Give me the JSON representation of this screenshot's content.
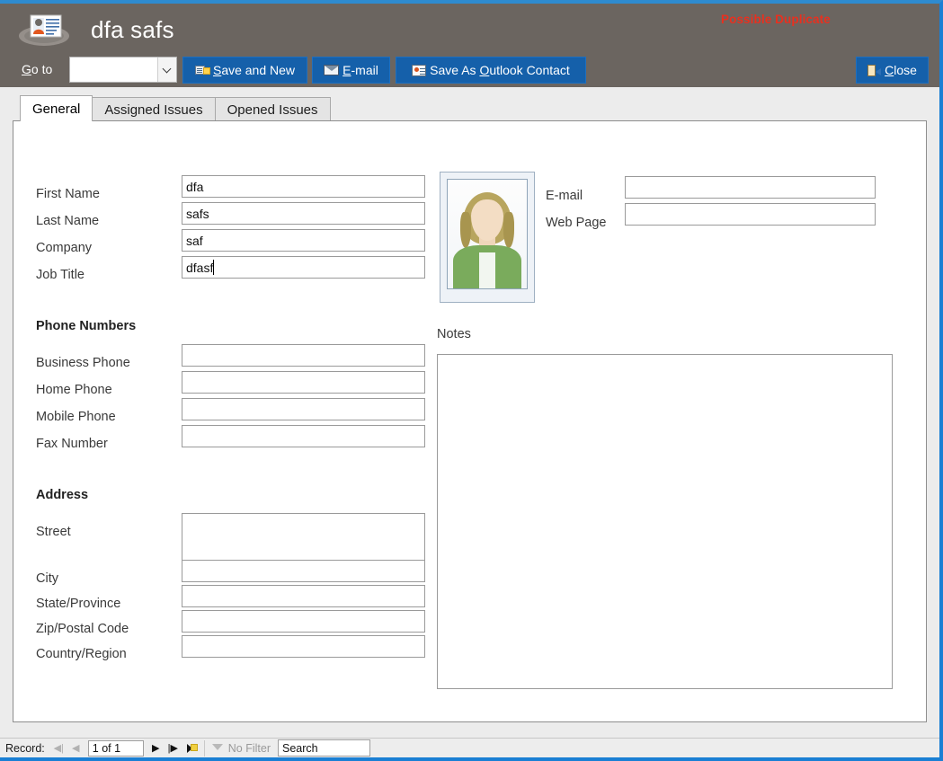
{
  "window": {
    "title": "dfa safs",
    "accent_color": "#1a7fd4",
    "header_bg": "#6b6560",
    "button_blue": "#1560aa",
    "warning_color": "#e8301f"
  },
  "header": {
    "app_icon": "contact-card-icon",
    "title": "dfa safs",
    "duplicate_warning": "Possible Duplicate",
    "goto_label_prefix": "G",
    "goto_label_rest": "o to",
    "goto_value": "",
    "dropdown_icon": "chevron-down-icon"
  },
  "commands": [
    {
      "id": "save-and-new",
      "icon": "save-new-icon",
      "pre": "",
      "accel": "S",
      "post": "ave and New"
    },
    {
      "id": "email",
      "icon": "envelope-icon",
      "pre": "",
      "accel": "E",
      "post": "-mail"
    },
    {
      "id": "save-as-outlook-contact",
      "icon": "outlook-contact-icon",
      "pre": "Save As ",
      "accel": "O",
      "post": "utlook Contact"
    },
    {
      "id": "close",
      "icon": "door-exit-icon",
      "pre": "",
      "accel": "C",
      "post": "lose"
    }
  ],
  "tabs": [
    {
      "label": "General",
      "active": true
    },
    {
      "label": "Assigned Issues",
      "active": false
    },
    {
      "label": "Opened Issues",
      "active": false
    }
  ],
  "form": {
    "left_fields": [
      {
        "label": "First Name",
        "value": "dfa",
        "focused": false
      },
      {
        "label": "Last Name",
        "value": "safs",
        "focused": false
      },
      {
        "label": "Company",
        "value": "saf",
        "focused": false
      },
      {
        "label": "Job Title",
        "value": "dfasf",
        "focused": true
      }
    ],
    "right_fields": [
      {
        "label": "E-mail",
        "value": ""
      },
      {
        "label": "Web Page",
        "value": ""
      }
    ],
    "phone_section_title": "Phone Numbers",
    "phone_fields": [
      {
        "label": "Business Phone",
        "value": ""
      },
      {
        "label": "Home Phone",
        "value": ""
      },
      {
        "label": "Mobile Phone",
        "value": ""
      },
      {
        "label": "Fax Number",
        "value": ""
      }
    ],
    "address_section_title": "Address",
    "address_fields": [
      {
        "label": "Street",
        "value": ""
      },
      {
        "label": "City",
        "value": ""
      },
      {
        "label": "State/Province",
        "value": ""
      },
      {
        "label": "Zip/Postal Code",
        "value": ""
      },
      {
        "label": "Country/Region",
        "value": ""
      }
    ],
    "notes_label": "Notes",
    "notes_value": "",
    "photo_alt": "contact-photo-placeholder"
  },
  "record_nav": {
    "record_label": "Record:",
    "first_icon": "first-record-icon",
    "previous_icon": "previous-record-icon",
    "position": "1 of 1",
    "next_icon": "next-record-icon",
    "last_icon": "last-record-icon",
    "new_icon": "new-record-icon",
    "filter_icon": "filter-icon",
    "filter_status": "No Filter",
    "search_placeholder": "Search",
    "search_value": ""
  }
}
